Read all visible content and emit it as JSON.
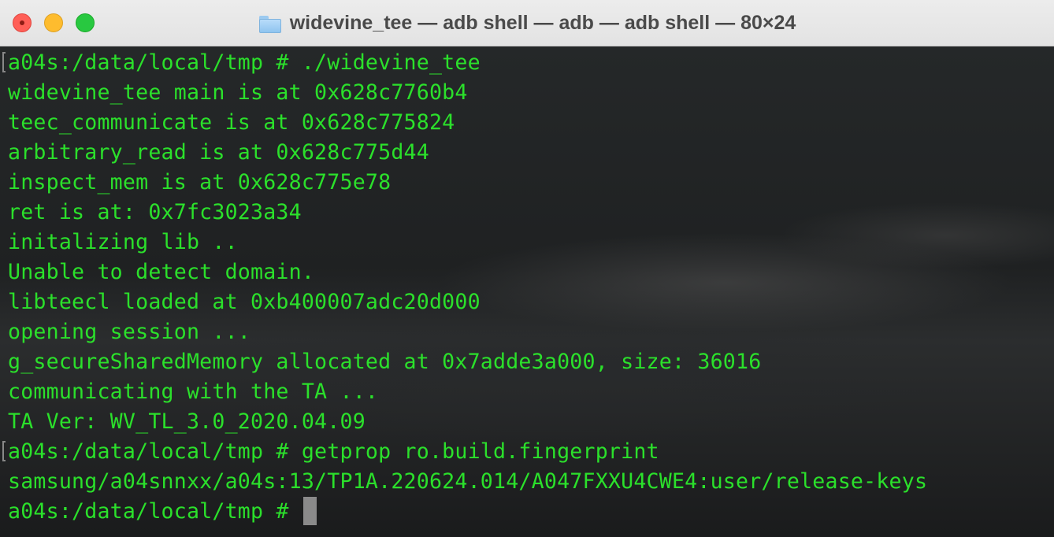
{
  "window": {
    "title": "widevine_tee — adb shell — adb — adb shell — 80×24",
    "title_icon": "folder-icon",
    "controls": [
      "close",
      "minimize",
      "maximize"
    ]
  },
  "terminal": {
    "text_color": "#2be02b",
    "lines": [
      "a04s:/data/local/tmp # ./widevine_tee",
      "widevine_tee main is at 0x628c7760b4",
      "teec_communicate is at 0x628c775824",
      "arbitrary_read is at 0x628c775d44",
      "inspect_mem is at 0x628c775e78",
      "ret is at: 0x7fc3023a34",
      "initalizing lib ..",
      "Unable to detect domain.",
      "libteecl loaded at 0xb400007adc20d000",
      "opening session ...",
      "g_secureSharedMemory allocated at 0x7adde3a000, size: 36016",
      "communicating with the TA ...",
      "TA Ver: WV_TL_3.0_2020.04.09",
      "a04s:/data/local/tmp # getprop ro.build.fingerprint",
      "samsung/a04snnxx/a04s:13/TP1A.220624.014/A047FXXU4CWE4:user/release-keys",
      "a04s:/data/local/tmp # "
    ]
  }
}
